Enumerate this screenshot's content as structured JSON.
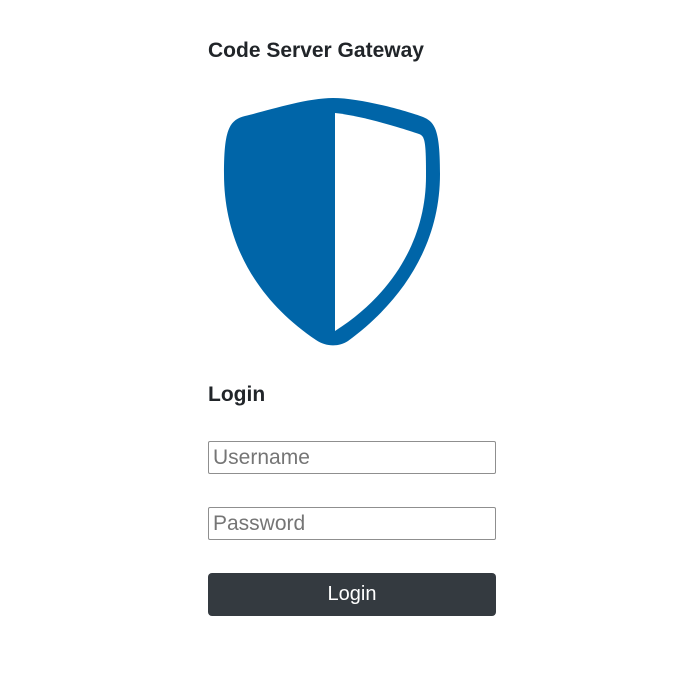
{
  "page": {
    "title": "Code Server Gateway",
    "logo_icon": "shield-icon",
    "brand_color": "#0065a8"
  },
  "login_form": {
    "heading": "Login",
    "username_placeholder": "Username",
    "password_placeholder": "Password",
    "submit_label": "Login",
    "button_color": "#343a40"
  }
}
